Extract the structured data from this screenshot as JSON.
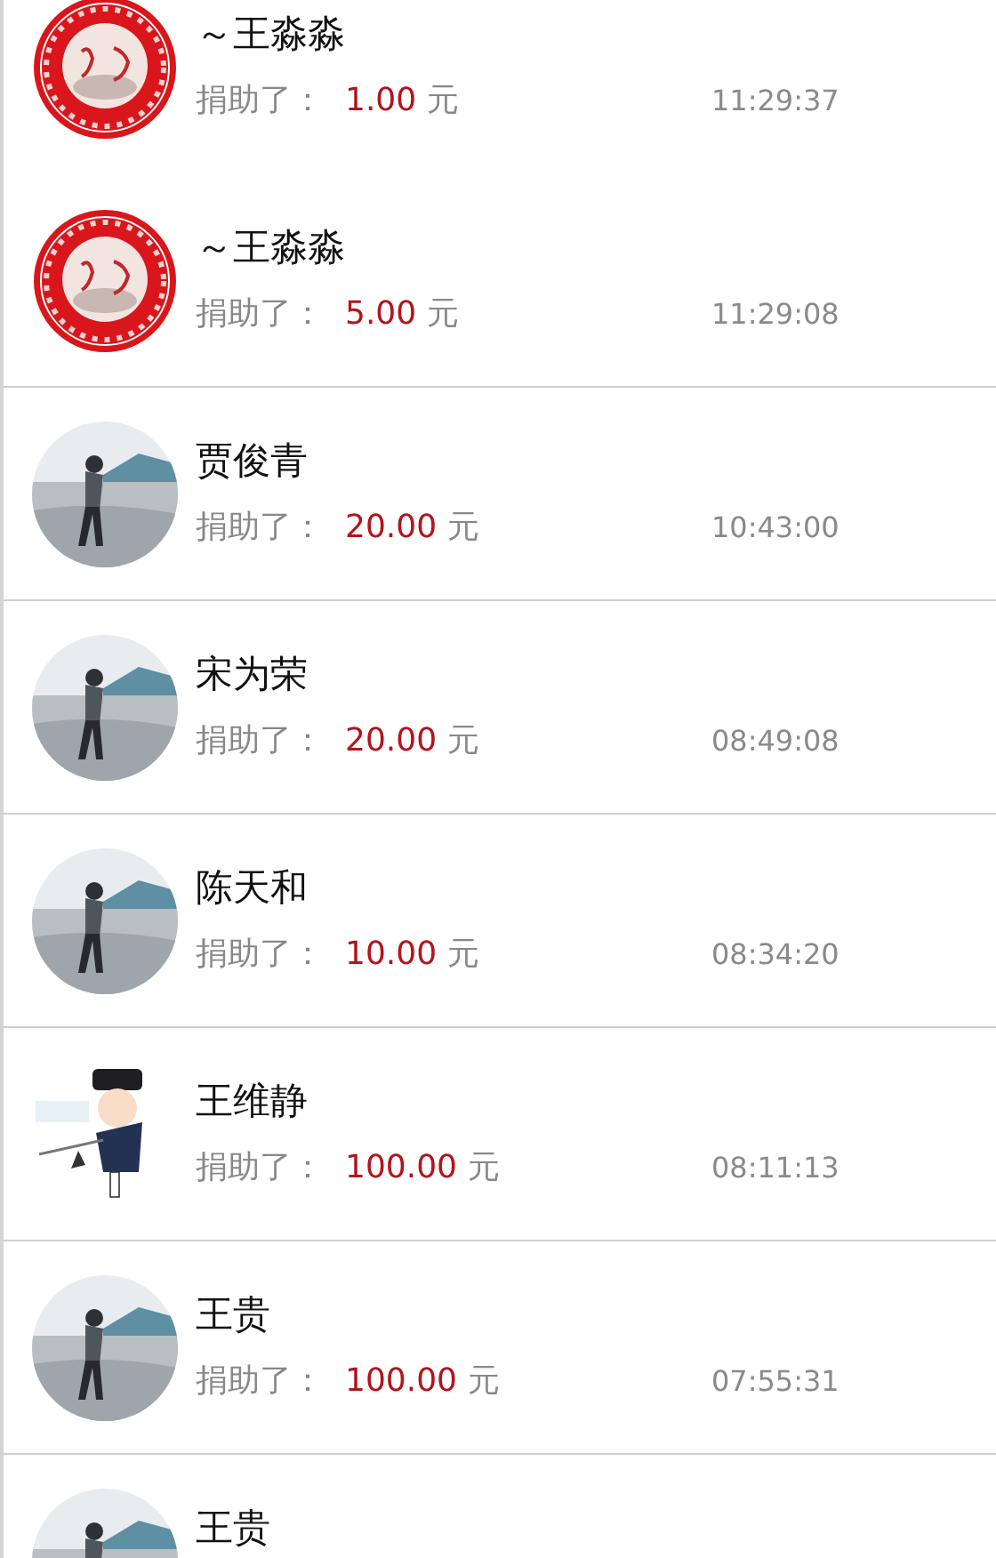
{
  "donations": [
    {
      "kind": "seal",
      "name": "～王淼淼",
      "label": "捐助了：",
      "amount": "1.00",
      "unit": "元",
      "time": "11:29:37"
    },
    {
      "kind": "seal",
      "name": "～王淼淼",
      "label": "捐助了：",
      "amount": "5.00",
      "unit": "元",
      "time": "11:29:08"
    },
    {
      "name": "贾俊青",
      "label": "捐助了：",
      "amount": "20.00",
      "unit": "元",
      "time": "10:43:00"
    },
    {
      "name": "宋为荣",
      "label": "捐助了：",
      "amount": "20.00",
      "unit": "元",
      "time": "08:49:08"
    },
    {
      "name": "陈天和",
      "label": "捐助了：",
      "amount": "10.00",
      "unit": "元",
      "time": "08:34:20"
    },
    {
      "kind": "cartoon",
      "name": "王维静",
      "label": "捐助了：",
      "amount": "100.00",
      "unit": "元",
      "time": "08:11:13"
    },
    {
      "name": "王贵",
      "label": "捐助了：",
      "amount": "100.00",
      "unit": "元",
      "time": "07:55:31"
    },
    {
      "name": "王贵"
    }
  ]
}
